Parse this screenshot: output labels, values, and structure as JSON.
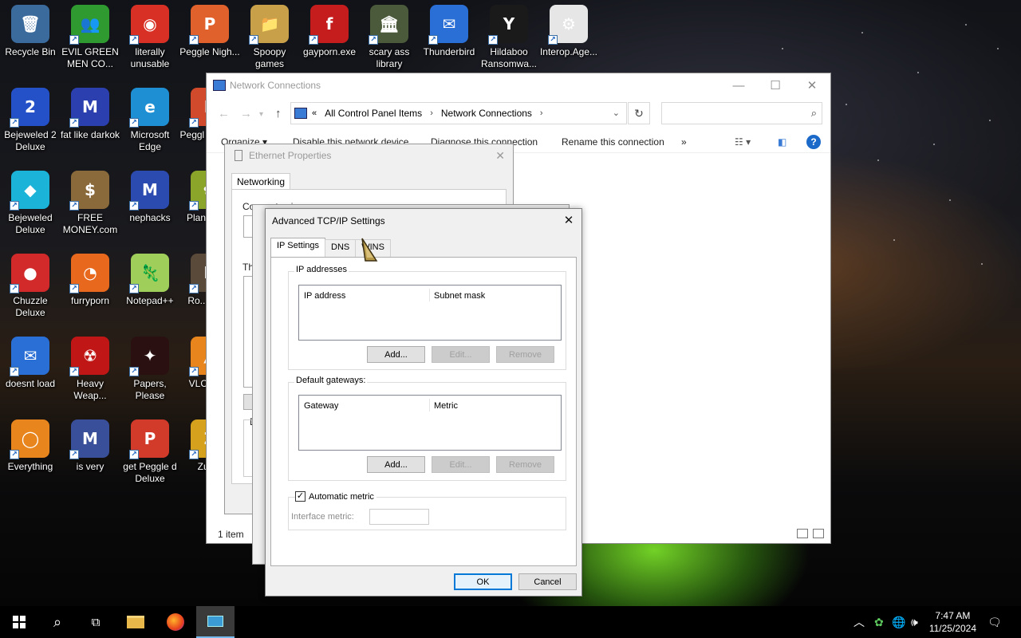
{
  "desktop": {
    "icons": [
      {
        "label": "Recycle Bin",
        "glyph": "🗑",
        "bg": "#3a6b9c"
      },
      {
        "label": "EVIL GREEN MEN CO...",
        "glyph": "👥",
        "bg": "#2f9a2f"
      },
      {
        "label": "literally unusable",
        "glyph": "◉",
        "bg": "#d93025"
      },
      {
        "label": "Peggle Nigh...",
        "glyph": "P",
        "bg": "#e0612b"
      },
      {
        "label": "Spoopy games",
        "glyph": "📁",
        "bg": "#c8a04a"
      },
      {
        "label": "gayporn.exe",
        "glyph": "f",
        "bg": "#c51d1d"
      },
      {
        "label": "scary ass library",
        "glyph": "🏛",
        "bg": "#4b5a3a"
      },
      {
        "label": "Thunderbird",
        "glyph": "✉",
        "bg": "#2a6fd6"
      },
      {
        "label": "Hildaboo Ransomwa...",
        "glyph": "Y",
        "bg": "#1a1a1a"
      },
      {
        "label": "Interop.Age...",
        "glyph": "⚙",
        "bg": "#e6e6e6"
      },
      {
        "label": "Bejeweled 2 Deluxe",
        "glyph": "2",
        "bg": "#2450c8"
      },
      {
        "label": "fat like darkok",
        "glyph": "M",
        "bg": "#2b3fae"
      },
      {
        "label": "Microsoft Edge",
        "glyph": "e",
        "bg": "#1f8fd4"
      },
      {
        "label": "Peggl of Wa...",
        "glyph": "P",
        "bg": "#d04a2b"
      },
      {
        "label": "Bejeweled Deluxe",
        "glyph": "◆",
        "bg": "#1bb3d8"
      },
      {
        "label": "FREE MONEY.com",
        "glyph": "$",
        "bg": "#8a6a3a"
      },
      {
        "label": "nephacks",
        "glyph": "M",
        "bg": "#2c4bb0"
      },
      {
        "label": "Plan Zon...",
        "glyph": "✿",
        "bg": "#8aa52a"
      },
      {
        "label": "Chuzzle Deluxe",
        "glyph": "●",
        "bg": "#d22a2a"
      },
      {
        "label": "furryporn",
        "glyph": "◔",
        "bg": "#e8681d"
      },
      {
        "label": "Notepad++",
        "glyph": "🦎",
        "bg": "#9fcf5a"
      },
      {
        "label": "Ro... Ma...",
        "glyph": "R",
        "bg": "#5a4a3a"
      },
      {
        "label": "doesnt load",
        "glyph": "✉",
        "bg": "#2a6fd6"
      },
      {
        "label": "Heavy Weap...",
        "glyph": "☢",
        "bg": "#c01616"
      },
      {
        "label": "Papers, Please",
        "glyph": "✦",
        "bg": "#2a1010"
      },
      {
        "label": "VLC pla...",
        "glyph": "▲",
        "bg": "#e8851d"
      },
      {
        "label": "Everything",
        "glyph": "◯",
        "bg": "#e8851d"
      },
      {
        "label": "is very",
        "glyph": "M",
        "bg": "#3a4f9a"
      },
      {
        "label": "get Peggle d Deluxe",
        "glyph": "P",
        "bg": "#d23a2a"
      },
      {
        "label": "Zuma",
        "glyph": "Z",
        "bg": "#d6a21d"
      }
    ]
  },
  "explorer": {
    "title": "Network Connections",
    "breadcrumb": {
      "prefix": "«",
      "items": [
        "All Control Panel Items",
        "Network Connections"
      ]
    },
    "commands": [
      "Organize ▾",
      "Disable this network device",
      "Diagnose this connection",
      "Rename this connection",
      "»"
    ],
    "status": "1 item"
  },
  "ethernet": {
    "title": "Ethernet Properties",
    "tab": "Networking",
    "connect_using": "Connect using:",
    "this_uses": "Th",
    "desc": "D"
  },
  "advanced": {
    "title": "Advanced TCP/IP Settings",
    "tabs": [
      "IP Settings",
      "DNS",
      "WINS"
    ],
    "ip_group": {
      "title": "IP addresses",
      "col1": "IP address",
      "col2": "Subnet mask",
      "add": "Add...",
      "edit": "Edit...",
      "remove": "Remove"
    },
    "gw_group": {
      "title": "Default gateways:",
      "col1": "Gateway",
      "col2": "Metric",
      "add": "Add...",
      "edit": "Edit...",
      "remove": "Remove"
    },
    "metric": {
      "checkbox_label": "Automatic metric",
      "checked": true,
      "interface_label": "Interface metric:",
      "interface_value": ""
    },
    "ok": "OK",
    "cancel": "Cancel"
  },
  "taskbar": {
    "time": "7:47 AM",
    "date": "11/25/2024"
  }
}
